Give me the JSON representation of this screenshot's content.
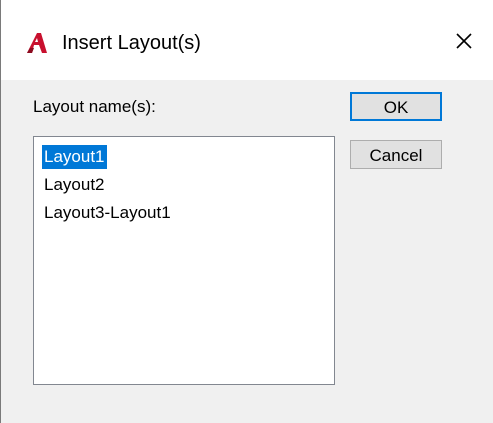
{
  "window": {
    "title": "Insert Layout(s)",
    "app_icon": "autocad-a-icon",
    "close_icon": "close-icon",
    "accent_color": "#0078d7",
    "logo_color": "#c8102e"
  },
  "form": {
    "label": "Layout name(s):",
    "layouts": [
      {
        "name": "Layout1",
        "selected": true
      },
      {
        "name": "Layout2",
        "selected": false
      },
      {
        "name": "Layout3-Layout1",
        "selected": false
      }
    ]
  },
  "buttons": {
    "ok_label": "OK",
    "cancel_label": "Cancel"
  }
}
